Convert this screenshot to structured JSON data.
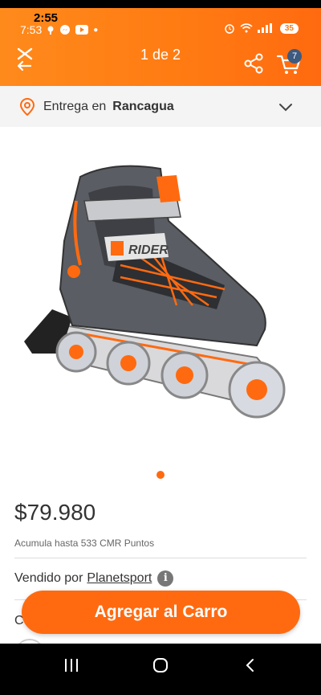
{
  "status_bar": {
    "outer_time": "2:55",
    "inner_time": "7:53",
    "battery": "35"
  },
  "header": {
    "page_indicator": "1 de 2",
    "cart_count": "7"
  },
  "delivery": {
    "prefix": "Entrega en",
    "city": "Rancagua"
  },
  "product": {
    "price": "$79.980",
    "points_text": "Acumula hasta 533 CMR Puntos",
    "seller_prefix": "Vendido por",
    "seller_name": "Planetsport",
    "partial_text": "C",
    "image_brand_text": "RIDER"
  },
  "actions": {
    "add_to_cart_label": "Agregar al Carro"
  },
  "colors": {
    "brand_orange": "#ff6a10",
    "badge_blue": "#3d5a80"
  }
}
